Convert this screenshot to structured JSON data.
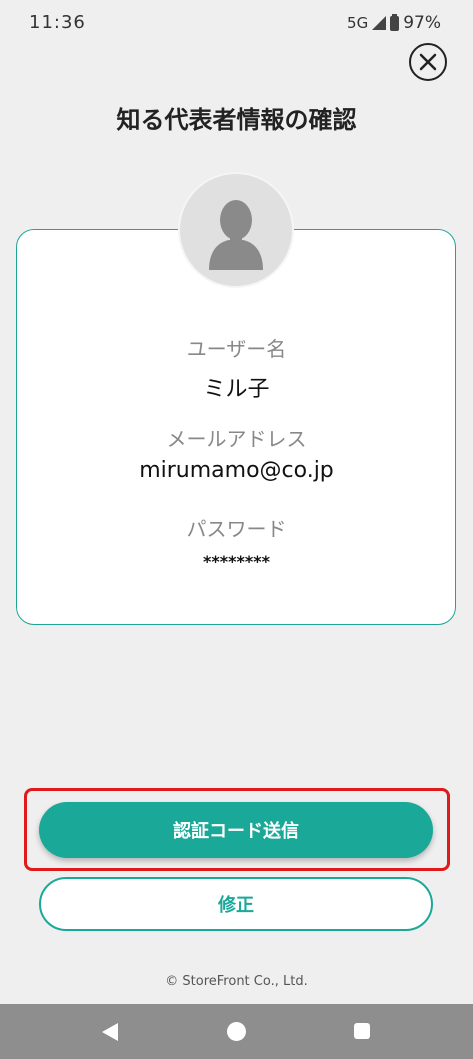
{
  "status_bar": {
    "time": "11:36",
    "network": "5G",
    "battery": "97%"
  },
  "header": {
    "title": "知る代表者情報の確認",
    "close_icon": "close-circle-icon"
  },
  "profile": {
    "avatar_icon": "person-silhouette-icon",
    "fields": [
      {
        "label": "ユーザー名",
        "value": "ミル子"
      },
      {
        "label": "メールアドレス",
        "value": "mirumamo@co.jp"
      },
      {
        "label": "パスワード",
        "value": "********"
      }
    ]
  },
  "actions": {
    "send_code_label": "認証コード送信",
    "edit_label": "修正"
  },
  "footer": {
    "copyright": "© StoreFront Co., Ltd."
  },
  "nav_bar": {
    "icons": [
      "back-icon",
      "home-icon",
      "recents-icon"
    ]
  },
  "colors": {
    "accent": "#1aa898",
    "highlight": "#e0191b",
    "background": "#efefef"
  }
}
